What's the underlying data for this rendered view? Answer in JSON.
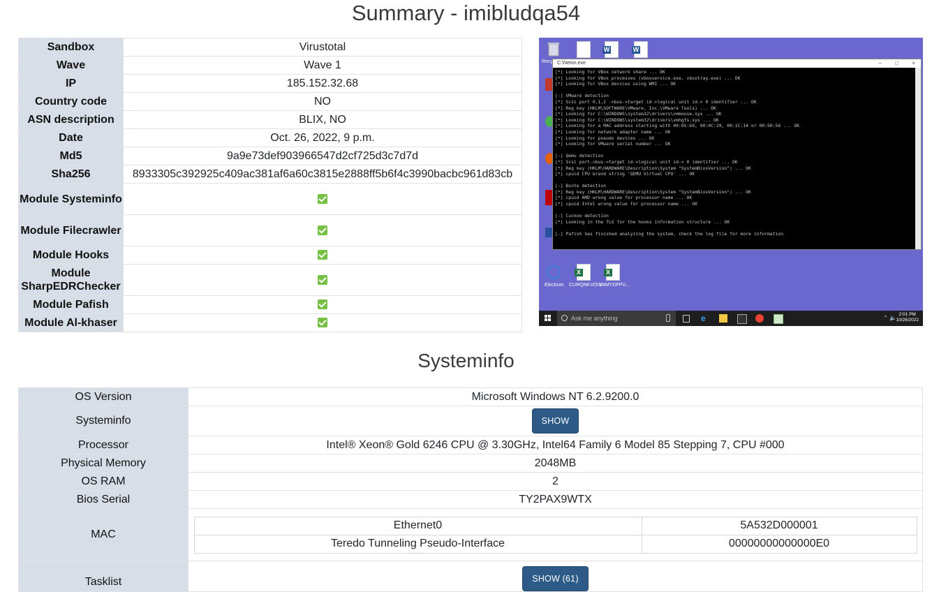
{
  "page": {
    "title": "Summary - imibludqa54",
    "systeminfo_heading": "Systeminfo"
  },
  "summary": {
    "rows": [
      {
        "label": "Sandbox",
        "value": "Virustotal"
      },
      {
        "label": "Wave",
        "value": "Wave 1"
      },
      {
        "label": "IP",
        "value": "185.152.32.68"
      },
      {
        "label": "Country code",
        "value": "NO"
      },
      {
        "label": "ASN description",
        "value": "BLIX, NO"
      },
      {
        "label": "Date",
        "value": "Oct. 26, 2022, 9 p.m."
      },
      {
        "label": "Md5",
        "value": "9a9e73def903966547d2cf725d3c7d7d"
      },
      {
        "label": "Sha256",
        "value": "8933305c392925c409ac381af6a60c3815e2888ff5b6f4c3990bacbc961d83cb"
      }
    ],
    "modules": [
      {
        "label": "Module Systeminfo",
        "checked": true
      },
      {
        "label": "Module Filecrawler",
        "checked": true
      },
      {
        "label": "Module Hooks",
        "checked": true
      },
      {
        "label": "Module SharpEDRChecker",
        "checked": true
      },
      {
        "label": "Module Pafish",
        "checked": true
      },
      {
        "label": "Module Al-khaser",
        "checked": true
      }
    ]
  },
  "screenshot": {
    "console_title": "C:\\Neton.exe",
    "console_lines": [
      "[*] Looking for VBox network share ... OK",
      "[*] Looking for VBox processes (vboxservice.exe, vboxtray.exe) ... OK",
      "[*] Looking for VBox devices using WMI ... OK",
      "",
      "[-] VMware detection",
      "[*] Scsi port 0,1,2 ->bus->target id->logical unit id-> 0 identifier ... OK",
      "[*] Reg key (HKLM\\SOFTWARE\\VMware, Inc.\\VMware Tools) ... OK",
      "[*] Looking for C:\\WINDOWS\\system32\\drivers\\vmmouse.sys ... OK",
      "[*] Looking for C:\\WINDOWS\\system32\\drivers\\vmhgfs.sys ... OK",
      "[*] Looking for a MAC address starting with 00:05:69, 00:0C:29, 00:1C:14 or 00:50:56 ... OK",
      "[*] Looking for network adapter name ... OK",
      "[*] Looking for pseudo devices ... OK",
      "[*] Looking for VMware serial number ... OK",
      "",
      "[-] Qemu detection",
      "[*] Scsi port->bus->target id->logical unit id-> 0 identifier ... OK",
      "[*] Reg key (HKLM\\HARDWARE\\Description\\System \"SystemBiosVersion\") ... OK",
      "[*] cpuid CPU brand string 'QEMU Virtual CPU' ... OK",
      "",
      "[-] Bochs detection",
      "[*] Reg key (HKLM\\HARDWARE\\Description\\System \"SystemBiosVersion\") ... OK",
      "[*] cpuid AMD wrong value for processor name ... OK",
      "[*] cpuid Intel wrong value for processor name ... OK",
      "",
      "[-] Cuckoo detection",
      "[*] Looking in the TLS for the hooks information structure ... OK",
      "",
      "[-] Pafish has finished analyzing the system, check the log file for more information"
    ],
    "desktop_labels": {
      "recycle": "Recyc",
      "electrum": "Electrum",
      "xls1": "CURQNKVOIX",
      "xls2": "VAMYDFPU..."
    },
    "taskbar": {
      "search_placeholder": "Ask me anything",
      "time": "2:01 PM",
      "date": "10/26/2022"
    },
    "colors": {
      "desktop": "#6a67cf",
      "taskbar": "#1e1e1e"
    }
  },
  "systeminfo": {
    "os_version_label": "OS Version",
    "os_version": "Microsoft Windows NT 6.2.9200.0",
    "systeminfo_label": "Systeminfo",
    "show_button": "SHOW",
    "processor_label": "Processor",
    "processor": "Intel® Xeon® Gold 6246 CPU @ 3.30GHz, Intel64 Family 6 Model 85 Stepping 7, CPU #000",
    "memory_label": "Physical Memory",
    "memory": "2048MB",
    "os_ram_label": "OS RAM",
    "os_ram": "2",
    "bios_label": "Bios Serial",
    "bios": "TY2PAX9WTX",
    "mac_label": "MAC",
    "mac": [
      {
        "iface": "Ethernet0",
        "addr": "5A532D000001"
      },
      {
        "iface": "Teredo Tunneling Pseudo-Interface",
        "addr": "00000000000000E0"
      }
    ],
    "tasklist_label": "Tasklist",
    "tasklist_button": "SHOW (61)"
  },
  "colors": {
    "label_bg": "#d7dee7",
    "button": "#2d5a87",
    "check": "#76c043"
  }
}
